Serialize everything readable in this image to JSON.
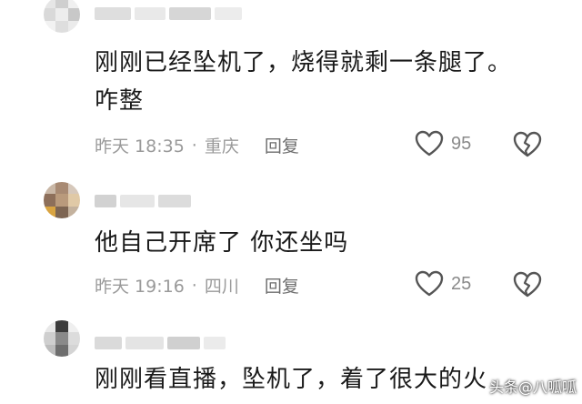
{
  "comments": [
    {
      "text_lines": [
        "刚刚已经坠机了，烧得就剩一条腿了。",
        "咋整"
      ],
      "time": "昨天 18:35",
      "location": "重庆",
      "reply_label": "回复",
      "likes": "95",
      "like_icon": "heart-outline-icon",
      "dislike_icon": "broken-heart-icon"
    },
    {
      "text_lines": [
        "他自己开席了 你还坐吗"
      ],
      "time": "昨天 19:16",
      "location": "四川",
      "reply_label": "回复",
      "likes": "25",
      "like_icon": "heart-outline-icon",
      "dislike_icon": "broken-heart-icon"
    },
    {
      "text_lines": [
        "刚刚看直播，坠机了，着了很大的火"
      ]
    }
  ],
  "watermark": "头条@八呱呱"
}
